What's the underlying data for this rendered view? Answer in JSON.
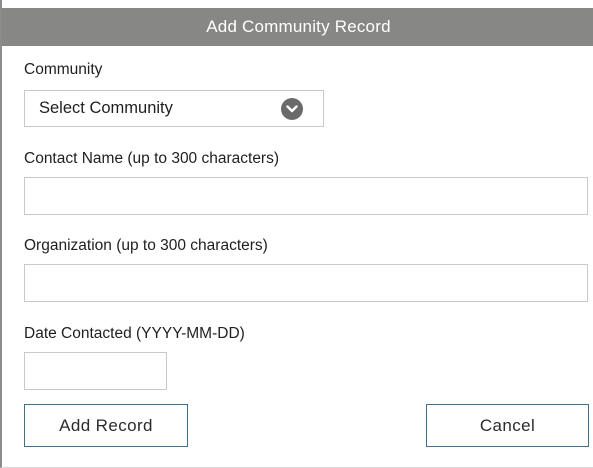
{
  "dialog": {
    "title": "Add Community Record"
  },
  "community": {
    "label": "Community",
    "selected": "Select Community",
    "icon": "chevron-down-circle-icon"
  },
  "contact_name": {
    "label": "Contact Name (up to 300 characters)",
    "value": "",
    "placeholder": ""
  },
  "organization": {
    "label": "Organization (up to 300 characters)",
    "value": "",
    "placeholder": ""
  },
  "date_contacted": {
    "label": "Date Contacted (YYYY-MM-DD)",
    "value": "",
    "placeholder": ""
  },
  "actions": {
    "add_label": "Add Record",
    "cancel_label": "Cancel"
  },
  "colors": {
    "header_bg": "#878786",
    "header_text": "#ffffff",
    "button_border": "#3f6f8a",
    "input_border": "#c9c9c9"
  }
}
